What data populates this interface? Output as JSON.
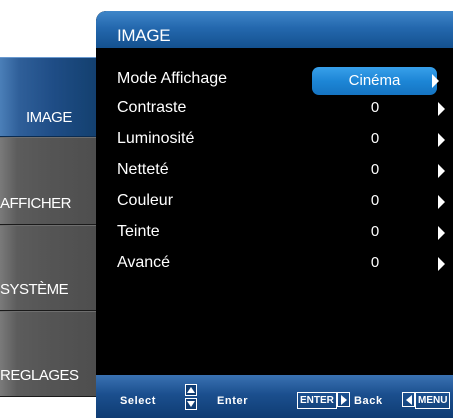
{
  "sidebar": {
    "items": [
      {
        "label": "IMAGE",
        "active": true
      },
      {
        "label": "AFFICHER",
        "active": false
      },
      {
        "label": "SYSTÈME",
        "active": false
      },
      {
        "label": "REGLAGES",
        "active": false
      }
    ]
  },
  "panel": {
    "title": "IMAGE",
    "rows": [
      {
        "label": "Mode Affichage",
        "value": "Cinéma"
      },
      {
        "label": "Contraste",
        "value": "0"
      },
      {
        "label": "Luminosité",
        "value": "0"
      },
      {
        "label": "Netteté",
        "value": "0"
      },
      {
        "label": "Couleur",
        "value": "0"
      },
      {
        "label": "Teinte",
        "value": "0"
      },
      {
        "label": "Avancé",
        "value": "0"
      }
    ]
  },
  "footer": {
    "select_label": "Select",
    "enter_label": "Enter",
    "enter_key": "ENTER",
    "back_label": "Back",
    "menu_key": "MENU"
  },
  "colors": {
    "active_tab": "#1f4d86",
    "header": "#2468ae",
    "selected_value": "#1d86d6",
    "panel_bg": "#000000"
  }
}
